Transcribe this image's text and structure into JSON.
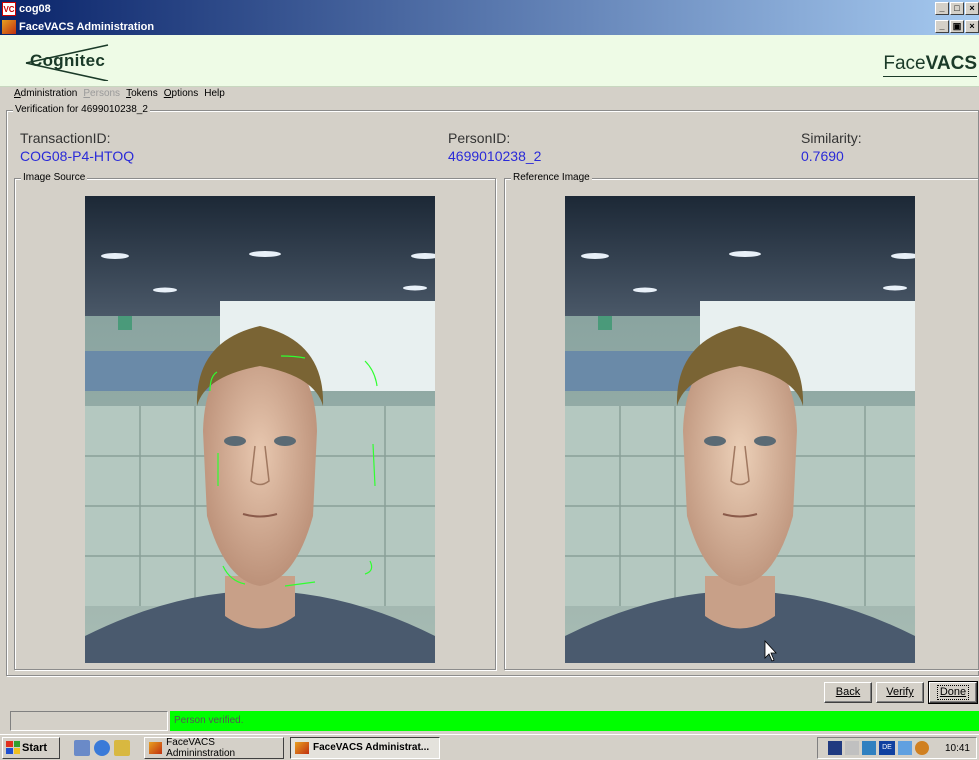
{
  "outer_window": {
    "title": "cog08",
    "icon": "vc-icon",
    "controls": [
      "_",
      "□",
      "×"
    ]
  },
  "inner_window": {
    "title": "FaceVACS Administration",
    "icon": "facevacs-icon",
    "controls": [
      "_",
      "🗗",
      "×"
    ]
  },
  "banner": {
    "logo_text": "Cognitec",
    "brand_part1": "Face",
    "brand_part2": "VACS"
  },
  "menu": [
    {
      "label": "Administration",
      "underline": "A",
      "rest": "dministration",
      "disabled": false
    },
    {
      "label": "Persons",
      "underline": "P",
      "rest": "ersons",
      "disabled": true
    },
    {
      "label": "Tokens",
      "underline": "T",
      "rest": "okens",
      "disabled": false
    },
    {
      "label": "Options",
      "underline": "O",
      "rest": "ptions",
      "disabled": false
    },
    {
      "label": "Help",
      "underline": "",
      "rest": "Help",
      "disabled": false
    }
  ],
  "verification": {
    "legend": "Verification for 4699010238_2",
    "transaction_label": "TransactionID:",
    "transaction_value": "COG08-P4-HTOQ",
    "person_label": "PersonID:",
    "person_value": "4699010238_2",
    "similarity_label": "Similarity:",
    "similarity_value": "0.7690"
  },
  "image_source": {
    "legend": "Image Source"
  },
  "reference_image": {
    "legend": "Reference Image"
  },
  "buttons": {
    "back": "Back",
    "verify": "Verify",
    "done": "Done"
  },
  "status": {
    "left": "",
    "message": "Person verified.",
    "color": "#00ff00"
  },
  "taskbar": {
    "start": "Start",
    "tasks": [
      "FaceVACS Admininstration",
      "FaceVACS Administrat..."
    ],
    "clock": "10:41",
    "tray_lang": "DE"
  },
  "colors": {
    "accent_text": "#2a2ad8",
    "banner_bg": "#eefbe6",
    "title_gradient_start": "#0a246a",
    "title_gradient_end": "#a6caf0"
  }
}
